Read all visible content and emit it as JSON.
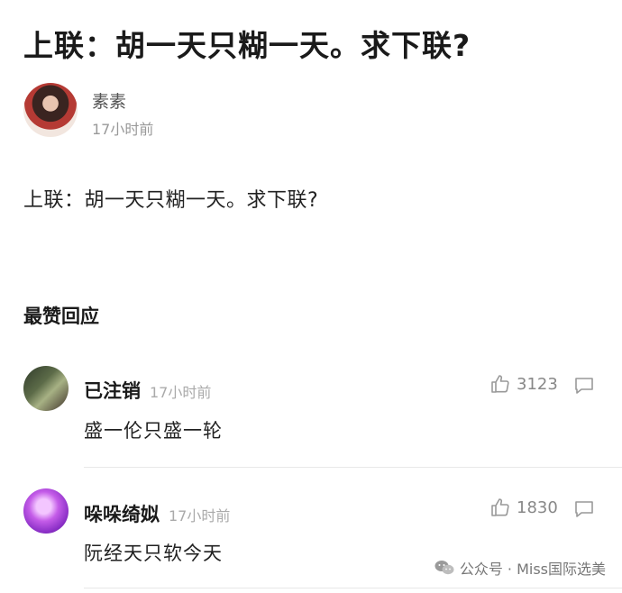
{
  "post": {
    "title": "上联：胡一天只糊一天。求下联?",
    "author": "素素",
    "time": "17小时前",
    "body": "上联：胡一天只糊一天。求下联?"
  },
  "section_title": "最赞回应",
  "comments": [
    {
      "name": "已注销",
      "time": "17小时前",
      "likes": "3123",
      "text": "盛一伦只盛一轮"
    },
    {
      "name": "哚哚绮姒",
      "time": "17小时前",
      "likes": "1830",
      "text": "阮经天只软今天"
    }
  ],
  "watermark": "公众号 · Miss国际选美"
}
